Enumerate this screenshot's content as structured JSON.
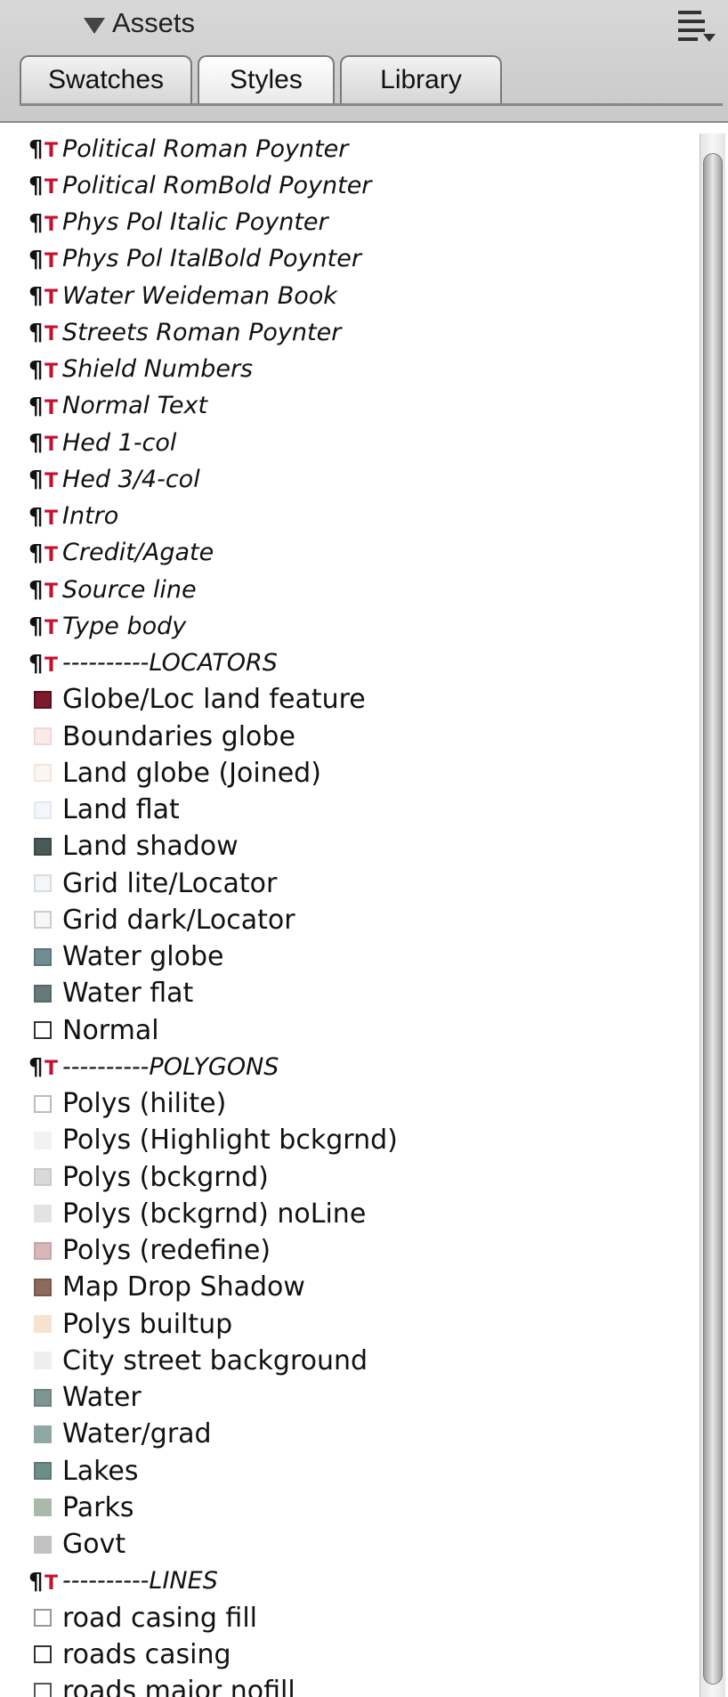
{
  "header": {
    "title": "Assets",
    "menu_icon": "panel-menu-icon"
  },
  "tabs": [
    {
      "label": "Swatches",
      "active": false
    },
    {
      "label": "Styles",
      "active": true
    },
    {
      "label": "Library",
      "active": false
    }
  ],
  "items": [
    {
      "kind": "style",
      "label": "Political Roman Poynter"
    },
    {
      "kind": "style",
      "label": "Political RomBold Poynter"
    },
    {
      "kind": "style",
      "label": "Phys Pol Italic Poynter"
    },
    {
      "kind": "style",
      "label": "Phys Pol ItalBold Poynter"
    },
    {
      "kind": "style",
      "label": "Water Weideman Book"
    },
    {
      "kind": "style",
      "label": "Streets Roman Poynter"
    },
    {
      "kind": "style",
      "label": "Shield Numbers"
    },
    {
      "kind": "style",
      "label": "Normal Text"
    },
    {
      "kind": "style",
      "label": "Hed 1-col"
    },
    {
      "kind": "style",
      "label": "Hed 3/4-col"
    },
    {
      "kind": "style",
      "label": "Intro"
    },
    {
      "kind": "style",
      "label": "Credit/Agate"
    },
    {
      "kind": "style",
      "label": "Source line"
    },
    {
      "kind": "style",
      "label": "Type body"
    },
    {
      "kind": "style",
      "label": "----------LOCATORS"
    },
    {
      "kind": "swatch",
      "label": "Globe/Loc land feature",
      "color": "#7d1a2c",
      "border": "#5a1020"
    },
    {
      "kind": "swatch",
      "label": "Boundaries globe",
      "color": "#fbeaea",
      "border": "#f0d8d8"
    },
    {
      "kind": "swatch",
      "label": "Land globe (Joined)",
      "color": "#fdf6f0",
      "border": "#f2e6dc"
    },
    {
      "kind": "swatch",
      "label": "Land flat",
      "color": "#f3f7fb",
      "border": "#e2e9f1"
    },
    {
      "kind": "swatch",
      "label": "Land shadow",
      "color": "#4a5a58",
      "border": "#3a4846"
    },
    {
      "kind": "swatch",
      "label": "Grid lite/Locator",
      "color": "#f4f6f8",
      "border": "#d9dde2"
    },
    {
      "kind": "swatch",
      "label": "Grid dark/Locator",
      "color": "#f7f7f7",
      "border": "#cccccc"
    },
    {
      "kind": "swatch",
      "label": "Water globe",
      "color": "#6f8d92",
      "border": "#5a767b"
    },
    {
      "kind": "swatch",
      "label": "Water flat",
      "color": "#667a7c",
      "border": "#55686a"
    },
    {
      "kind": "swatch",
      "label": "Normal",
      "color": "#ffffff",
      "border": "#333333"
    },
    {
      "kind": "style",
      "label": "----------POLYGONS"
    },
    {
      "kind": "swatch",
      "label": "Polys (hilite)",
      "color": "#ffffff",
      "border": "#bbbbbb"
    },
    {
      "kind": "swatch",
      "label": "Polys (Highlight bckgrnd)",
      "color": "#f2f2f2",
      "border": "#f2f2f2"
    },
    {
      "kind": "swatch",
      "label": "Polys (bckgrnd)",
      "color": "#d9d9d9",
      "border": "#c9c9c9"
    },
    {
      "kind": "swatch",
      "label": "Polys (bckgrnd) noLine",
      "color": "#e3e3e3",
      "border": "#e3e3e3"
    },
    {
      "kind": "swatch",
      "label": "Polys (redefine)",
      "color": "#d7b7b9",
      "border": "#c9a4a7"
    },
    {
      "kind": "swatch",
      "label": "Map Drop Shadow",
      "color": "#8e6a5e",
      "border": "#7a584d"
    },
    {
      "kind": "swatch",
      "label": "Polys builtup",
      "color": "#f5e3cf",
      "border": "#f5e3cf"
    },
    {
      "kind": "swatch",
      "label": "City street background",
      "color": "#eeeeee",
      "border": "#eeeeee"
    },
    {
      "kind": "swatch",
      "label": "Water",
      "color": "#7f9592",
      "border": "#6e8481"
    },
    {
      "kind": "swatch",
      "label": "Water/grad",
      "color": "#8ea8a3",
      "border": "#8ea8a3"
    },
    {
      "kind": "swatch",
      "label": "Lakes",
      "color": "#6d8d87",
      "border": "#5c7b75"
    },
    {
      "kind": "swatch",
      "label": "Parks",
      "color": "#a9b9ac",
      "border": "#a9b9ac"
    },
    {
      "kind": "swatch",
      "label": "Govt",
      "color": "#c2c2c2",
      "border": "#c2c2c2"
    },
    {
      "kind": "style",
      "label": "----------LINES"
    },
    {
      "kind": "swatch",
      "label": "road casing fill",
      "color": "#ffffff",
      "border": "#999999"
    },
    {
      "kind": "swatch",
      "label": "roads casing",
      "color": "#ffffff",
      "border": "#333333"
    },
    {
      "kind": "swatch",
      "label": "roads major nofill",
      "color": "#ffffff",
      "border": "#555555"
    }
  ]
}
